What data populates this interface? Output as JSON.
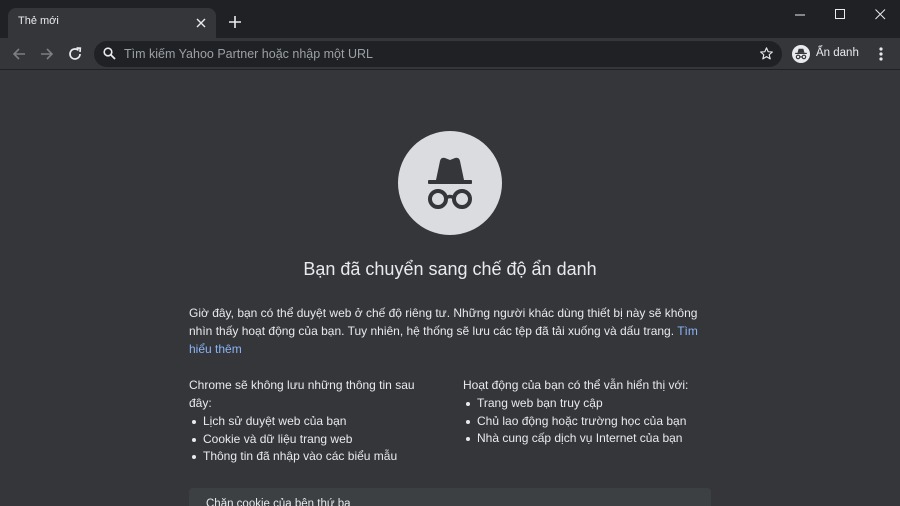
{
  "colors": {
    "frame": "#202124",
    "toolbar": "#35363a",
    "page_background": "#35363a",
    "text": "#e8eaed",
    "link": "#8ab4f8",
    "icon_circle": "#dadce0"
  },
  "tab": {
    "title": "Thẻ mới"
  },
  "omnibox": {
    "placeholder": "Tìm kiếm Yahoo Partner hoặc nhập một URL"
  },
  "profile": {
    "label": "Ẩn danh"
  },
  "page": {
    "heading": "Bạn đã chuyển sang chế độ ẩn danh",
    "intro": "Giờ đây, bạn có thể duyệt web ở chế độ riêng tư. Những người khác dùng thiết bị này sẽ không nhìn thấy hoạt động của bạn. Tuy nhiên, hệ thống sẽ lưu các tệp đã tải xuống và dấu trang.",
    "learn_more": "Tìm hiểu thêm",
    "not_saved": {
      "title": "Chrome sẽ không lưu những thông tin sau đây:",
      "items": [
        "Lịch sử duyệt web của bạn",
        "Cookie và dữ liệu trang web",
        "Thông tin đã nhập vào các biểu mẫu"
      ]
    },
    "visible_to": {
      "title": "Hoạt động của bạn có thể vẫn hiển thị với:",
      "items": [
        "Trang web bạn truy cập",
        "Chủ lao động hoặc trường học của bạn",
        "Nhà cung cấp dịch vụ Internet của bạn"
      ]
    },
    "card_title": "Chặn cookie của bên thứ ba"
  }
}
